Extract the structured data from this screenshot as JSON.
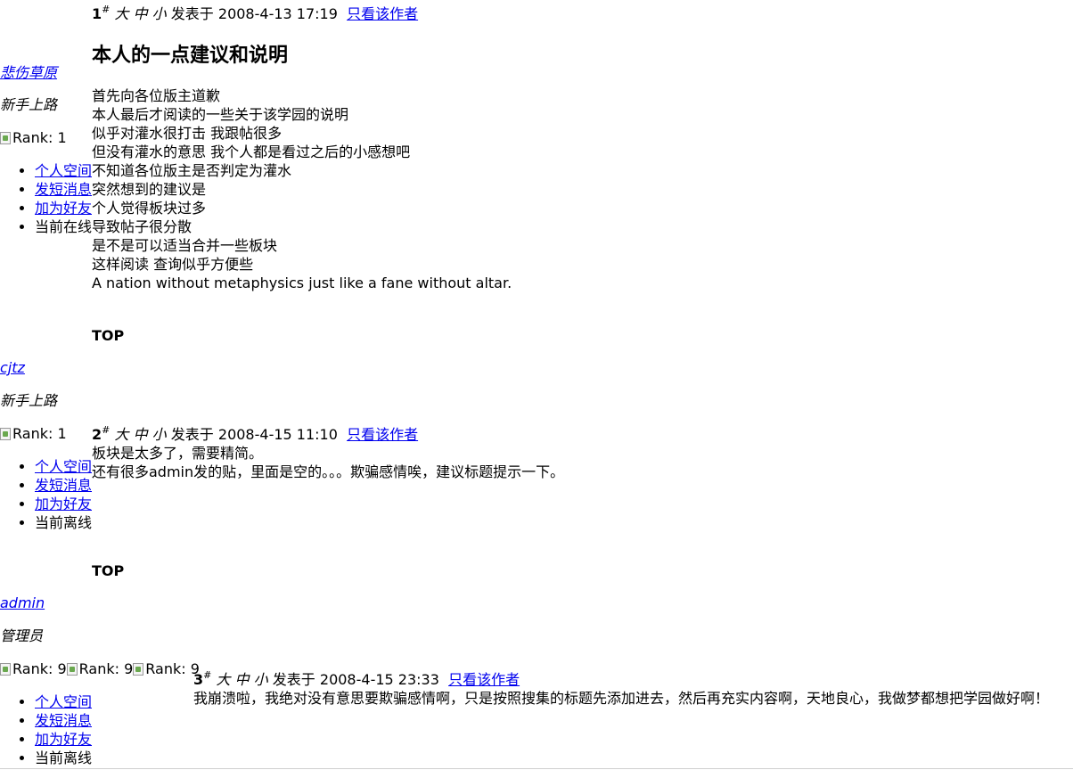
{
  "posts": [
    {
      "floor": "1",
      "floor_mark": "#",
      "size_large": "大",
      "size_medium": "中",
      "size_small": "小",
      "posted_label": "发表于",
      "timestamp": "2008-4-13 17:19",
      "only_author": "只看该作者",
      "title": "本人的一点建议和说明",
      "lines": [
        "首先向各位版主道歉",
        "本人最后才阅读的一些关于该学园的说明",
        "似乎对灌水很打击 我跟帖很多",
        "但没有灌水的意思 我个人都是看过之后的小感想吧",
        "不知道各位版主是否判定为灌水",
        "突然想到的建议是",
        "个人觉得板块过多",
        "导致帖子很分散",
        "是不是可以适当合并一些板块",
        "这样阅读 查询似乎方便些"
      ],
      "signature": "A nation without metaphysics just like a fane without altar.",
      "top": "TOP"
    },
    {
      "floor": "2",
      "floor_mark": "#",
      "size_large": "大",
      "size_medium": "中",
      "size_small": "小",
      "posted_label": "发表于",
      "timestamp": "2008-4-15 11:10",
      "only_author": "只看该作者",
      "lines": [
        "板块是太多了，需要精简。",
        "还有很多admin发的贴，里面是空的。。。欺骗感情唉，建议标题提示一下。"
      ],
      "top": "TOP"
    },
    {
      "floor": "3",
      "floor_mark": "#",
      "size_large": "大",
      "size_medium": "中",
      "size_small": "小",
      "posted_label": "发表于",
      "timestamp": "2008-4-15 23:33",
      "only_author": "只看该作者",
      "lines": [
        "我崩溃啦，我绝对没有意思要欺骗感情啊，只是按照搜集的标题先添加进去，然后再充实内容啊，天地良心，我做梦都想把学园做好啊！"
      ]
    }
  ],
  "users": [
    {
      "name": "悲伤草原",
      "group": "新手上路",
      "rank_alt": "Rank: 1",
      "menu": [
        "个人空间",
        "发短消息",
        "加为好友",
        "当前在线"
      ]
    },
    {
      "name": "cjtz",
      "group": "新手上路",
      "rank_alt": "Rank: 1",
      "menu": [
        "个人空间",
        "发短消息",
        "加为好友",
        "当前离线"
      ]
    },
    {
      "name": "admin",
      "group": "管理员",
      "rank_alt": "Rank: 9",
      "menu": [
        "个人空间",
        "发短消息",
        "加为好友",
        "当前离线"
      ]
    }
  ],
  "colors": {
    "link": "#0000ee",
    "text": "#000000",
    "background": "#ffffff"
  }
}
